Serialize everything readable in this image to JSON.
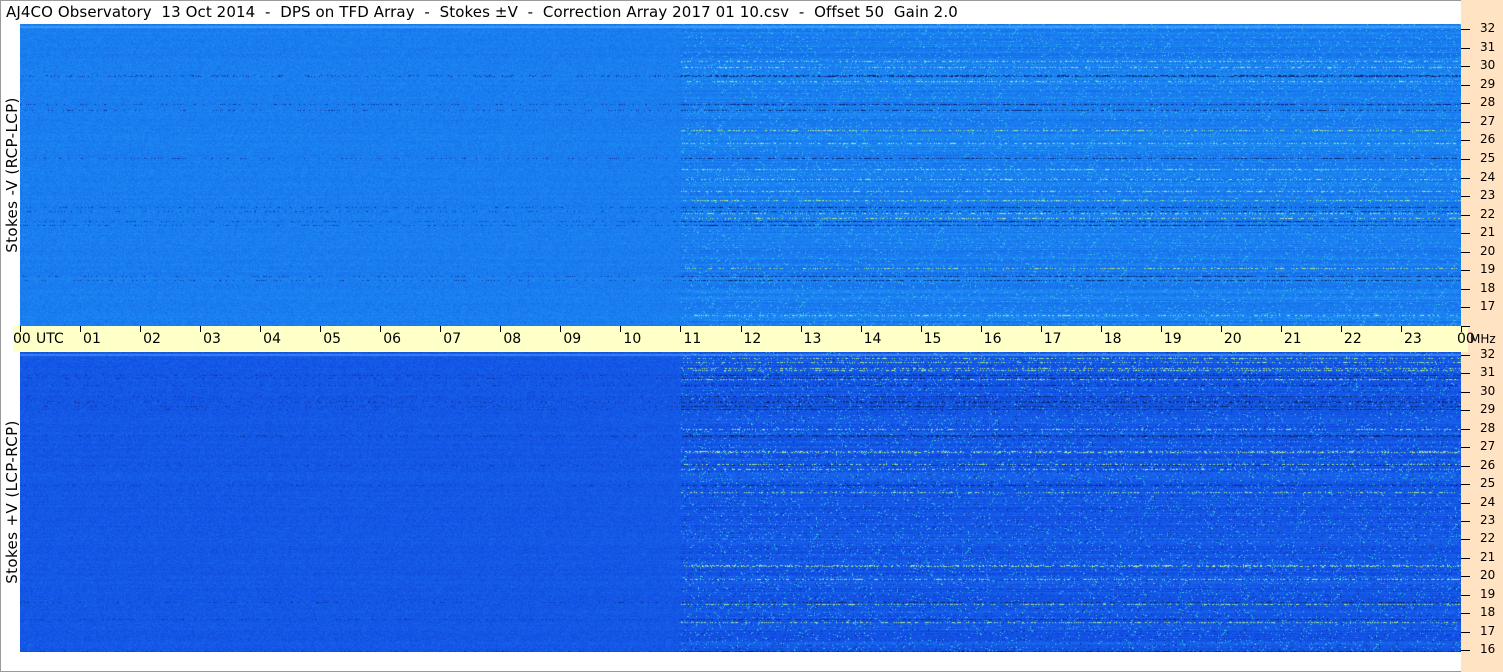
{
  "title": "AJ4CO Observatory  13 Oct 2014  -  DPS on TFD Array  -  Stokes ±V  -  Correction Array 2017 01 10.csv  -  Offset 50  Gain 2.0",
  "chart_data": {
    "type": "heatmap",
    "time_axis": {
      "unit_label": "UTC",
      "ticks": [
        "00",
        "01",
        "02",
        "03",
        "04",
        "05",
        "06",
        "07",
        "08",
        "09",
        "10",
        "11",
        "12",
        "13",
        "14",
        "15",
        "16",
        "17",
        "18",
        "19",
        "20",
        "21",
        "22",
        "23",
        "00"
      ]
    },
    "frequency_axis": {
      "unit_label": "MHz",
      "range": [
        16,
        32
      ],
      "ticks": [
        "32",
        "31",
        "30",
        "29",
        "28",
        "27",
        "26",
        "25",
        "24",
        "23",
        "22",
        "21",
        "20",
        "19",
        "18",
        "17",
        "16"
      ]
    },
    "panels": [
      {
        "label": "Stokes -V (RCP-LCP)",
        "base_color": "#1a7ef0"
      },
      {
        "label": "Stokes +V (LCP-RCP)",
        "base_color": "#1458e6"
      }
    ]
  }
}
